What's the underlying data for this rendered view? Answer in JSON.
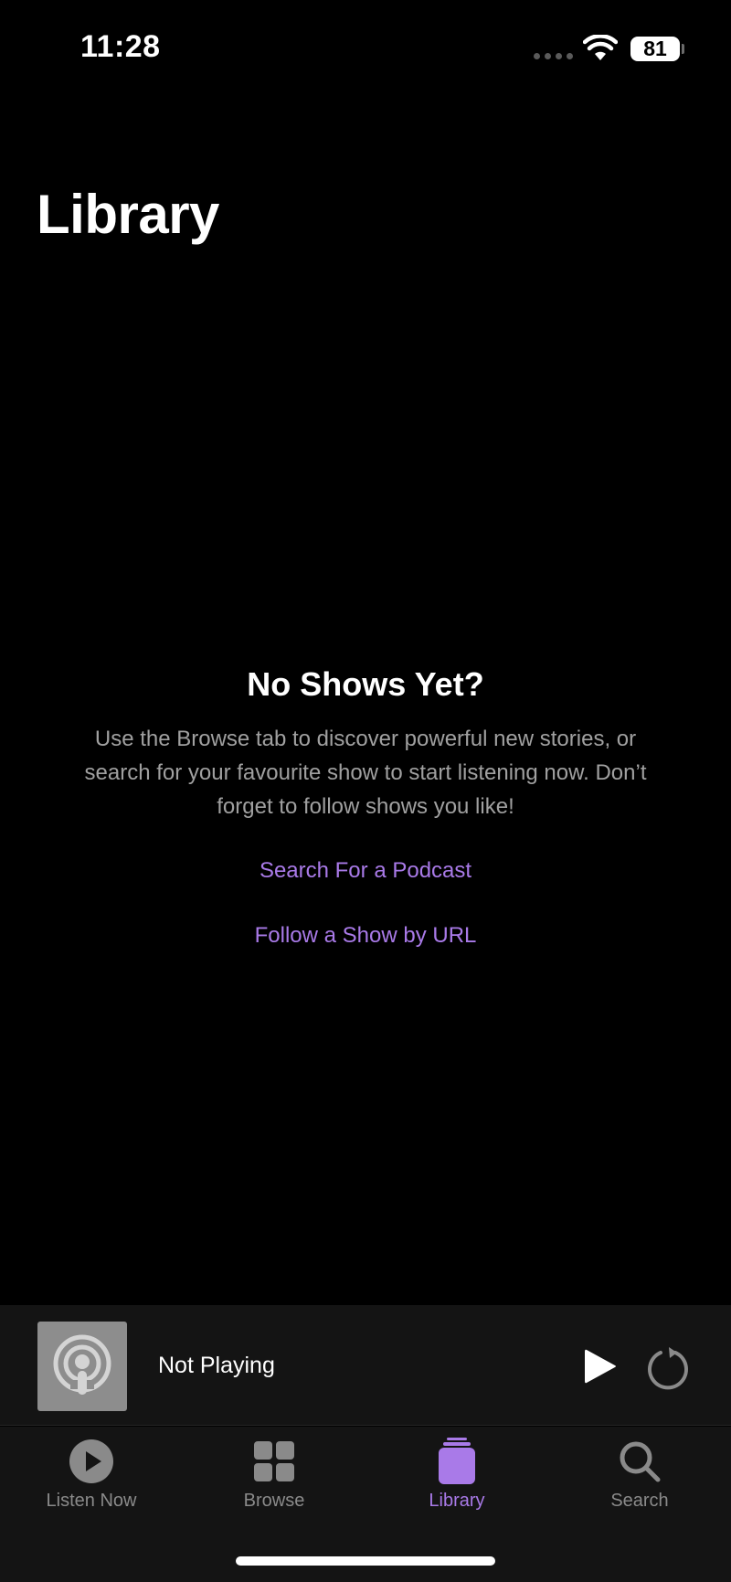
{
  "status_bar": {
    "time": "11:28",
    "battery": "81"
  },
  "page": {
    "title": "Library"
  },
  "empty_state": {
    "title": "No Shows Yet?",
    "description": "Use the Browse tab to discover powerful new stories, or search for your favourite show to start listening now. Don’t forget to follow shows you like!",
    "search_link": "Search For a Podcast",
    "url_link": "Follow a Show by URL"
  },
  "mini_player": {
    "label": "Not Playing"
  },
  "tab_bar": {
    "tabs": [
      {
        "label": "Listen Now",
        "icon": "play-circle-icon"
      },
      {
        "label": "Browse",
        "icon": "grid-icon"
      },
      {
        "label": "Library",
        "icon": "library-stack-icon",
        "active": true
      },
      {
        "label": "Search",
        "icon": "magnifier-icon"
      }
    ]
  },
  "colors": {
    "accent": "#a97ae8",
    "background": "#000000",
    "bar_background": "#141414",
    "inactive": "#8a8a8a"
  }
}
